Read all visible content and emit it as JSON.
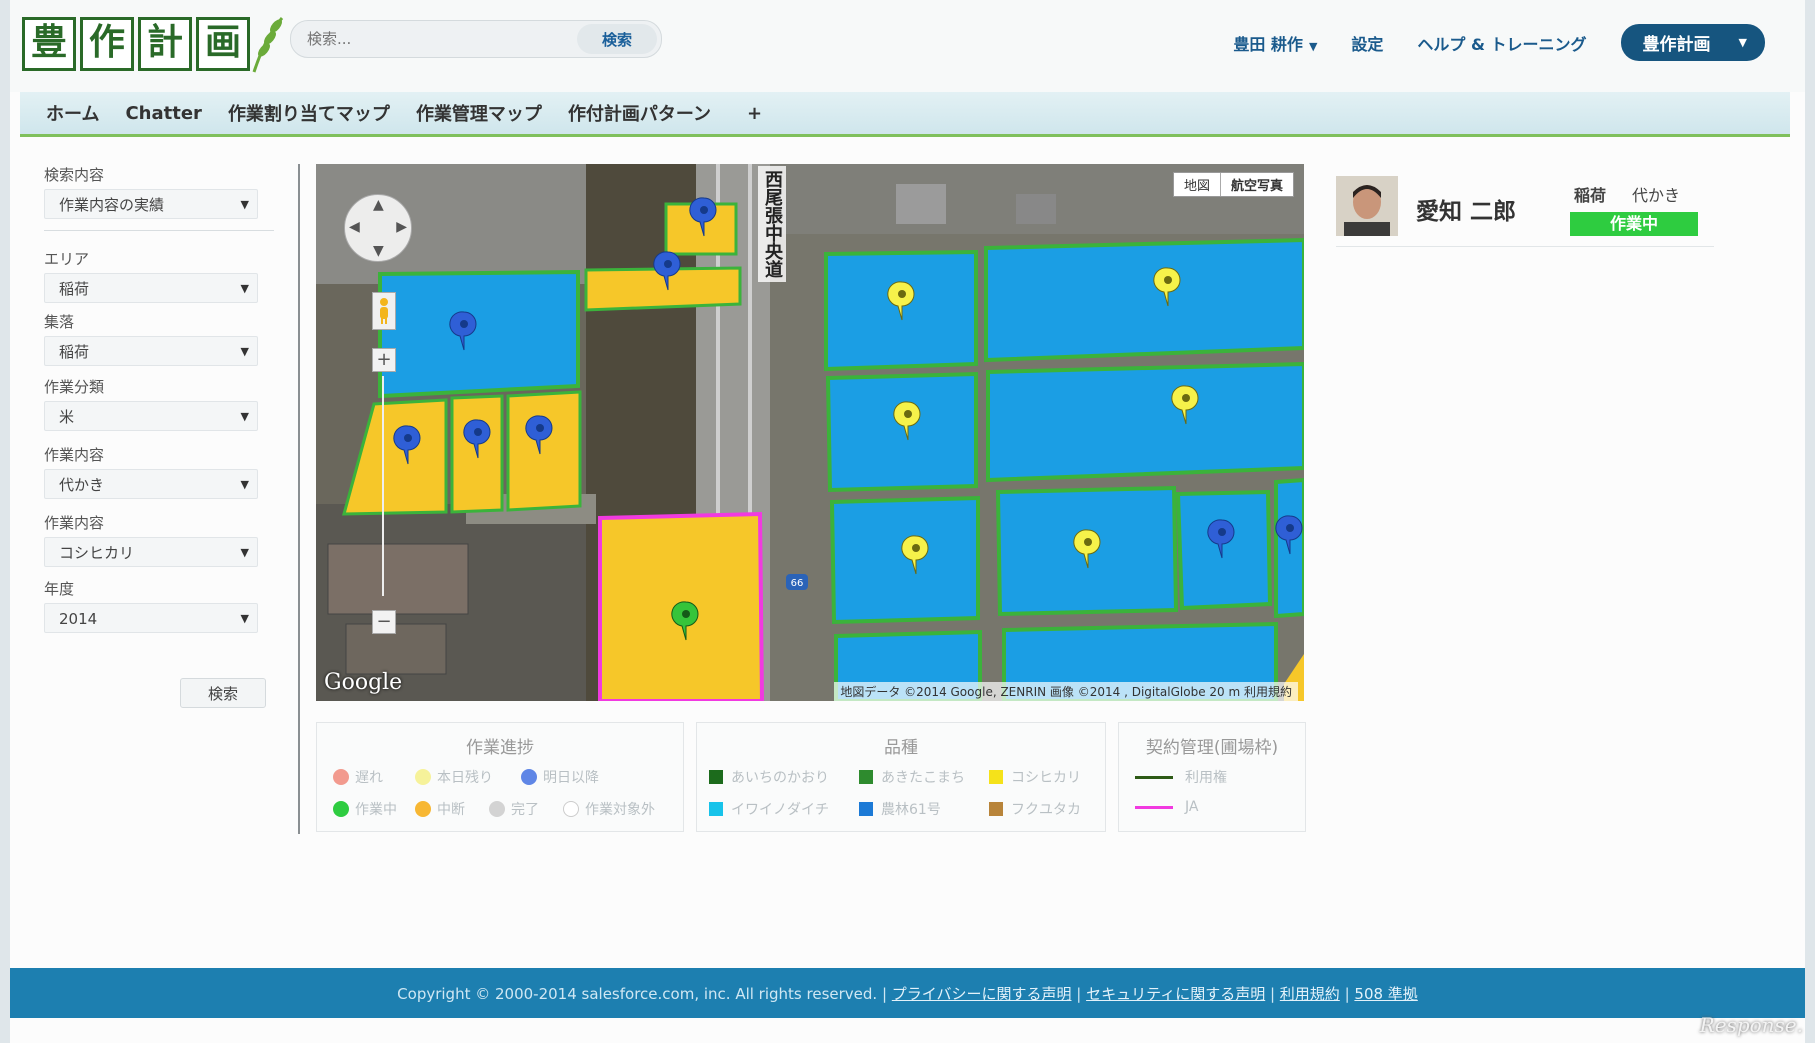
{
  "header": {
    "logo_chars": [
      "豊",
      "作",
      "計",
      "画"
    ],
    "search_placeholder": "検索...",
    "search_button": "検索",
    "user_menu": "豊田 耕作",
    "settings": "設定",
    "help": "ヘルプ & トレーニング",
    "app_menu": "豊作計画"
  },
  "nav": {
    "tabs": [
      "ホーム",
      "Chatter",
      "作業割り当てマップ",
      "作業管理マップ",
      "作付計画パターン"
    ],
    "plus": "+"
  },
  "sidebar": {
    "fields": [
      {
        "label": "検索内容",
        "value": "作業内容の実績"
      },
      {
        "label": "エリア",
        "value": "稲荷"
      },
      {
        "label": "集落",
        "value": "稲荷"
      },
      {
        "label": "作業分類",
        "value": "米"
      },
      {
        "label": "作業内容",
        "value": "代かき"
      },
      {
        "label": "作業内容",
        "value": "コシヒカリ"
      },
      {
        "label": "年度",
        "value": "2014"
      }
    ],
    "search_button": "検索"
  },
  "map": {
    "type_buttons": [
      "地図",
      "航空写真"
    ],
    "active_type": "航空写真",
    "road_label": "西尾張中央道",
    "route_shield": "66",
    "google_logo": "Google",
    "attribution": "地図データ ©2014 Google, ZENRIN 画像 ©2014 , DigitalGlobe   20 m       利用規約",
    "zoom_in": "+",
    "zoom_out": "−"
  },
  "profile": {
    "name": "愛知 二郎",
    "area": "稲荷",
    "task": "代かき",
    "status": "作業中",
    "status_color": "#2ecc40"
  },
  "legend_progress": {
    "title": "作業進捗",
    "items": [
      {
        "label": "遅れ",
        "color": "#f29a8e"
      },
      {
        "label": "本日残り",
        "color": "#f6f29a"
      },
      {
        "label": "明日以降",
        "color": "#5f86e6"
      },
      {
        "label": "作業中",
        "color": "#2ecc40"
      },
      {
        "label": "中断",
        "color": "#f7b733"
      },
      {
        "label": "完了",
        "color": "#d3d3d3"
      },
      {
        "label": "作業対象外",
        "color": "#ffffff"
      }
    ]
  },
  "legend_variety": {
    "title": "品種",
    "items": [
      {
        "label": "あいちのかおり",
        "color": "#1c6b1c"
      },
      {
        "label": "あきたこまち",
        "color": "#2e8b2e"
      },
      {
        "label": "コシヒカリ",
        "color": "#f5e21a"
      },
      {
        "label": "イワイノダイチ",
        "color": "#17c3ea"
      },
      {
        "label": "農林61号",
        "color": "#1c7ad6"
      },
      {
        "label": "フクユタカ",
        "color": "#b8843a"
      }
    ]
  },
  "legend_contract": {
    "title": "契約管理(圃場枠)",
    "items": [
      {
        "label": "利用権",
        "color": "#2d5a16"
      },
      {
        "label": "JA",
        "color": "#f13ae0"
      }
    ]
  },
  "footer": {
    "copyright": "Copyright © 2000-2014 salesforce.com, inc. All rights reserved. |",
    "links": [
      "プライバシーに関する声明",
      "セキュリティに関する声明",
      "利用規約",
      "508 準拠"
    ]
  },
  "watermark": "Response."
}
